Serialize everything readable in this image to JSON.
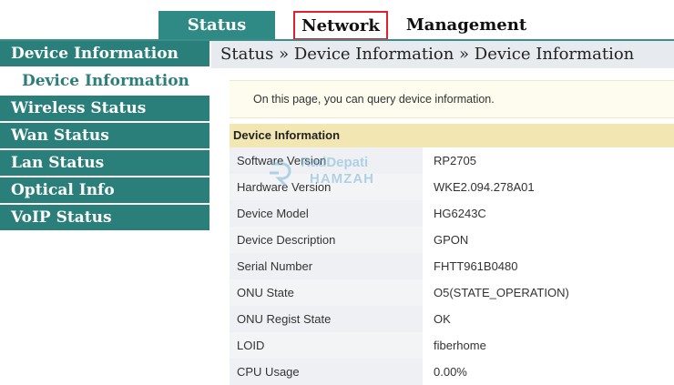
{
  "tabs": [
    {
      "label": "Status",
      "active": true
    },
    {
      "label": "Network",
      "highlighted": true
    },
    {
      "label": "Management"
    }
  ],
  "sidebar": {
    "items": [
      {
        "label": "Device Information",
        "type": "section"
      },
      {
        "label": "Device Information",
        "type": "sub",
        "selected": true
      },
      {
        "label": "Wireless Status",
        "type": "section"
      },
      {
        "label": "Wan Status",
        "type": "section"
      },
      {
        "label": "Lan Status",
        "type": "section"
      },
      {
        "label": "Optical Info",
        "type": "section"
      },
      {
        "label": "VoIP Status",
        "type": "section"
      }
    ]
  },
  "breadcrumb": "Status » Device Information » Device Information",
  "info_text": "On this page, you can query device information.",
  "section_title": "Device Information",
  "rows": [
    {
      "label": "Software Version",
      "value": "RP2705"
    },
    {
      "label": "Hardware Version",
      "value": "WKE2.094.278A01"
    },
    {
      "label": "Device Model",
      "value": "HG6243C"
    },
    {
      "label": "Device Description",
      "value": "GPON"
    },
    {
      "label": "Serial Number",
      "value": "FHTT961B0480"
    },
    {
      "label": "ONU State",
      "value": "O5(STATE_OPERATION)"
    },
    {
      "label": "ONU Regist State",
      "value": "OK"
    },
    {
      "label": "LOID",
      "value": "fiberhome"
    },
    {
      "label": "CPU Usage",
      "value": "0.00%"
    }
  ],
  "watermark": {
    "line1": "RadDepati",
    "line2": "HAMZAH",
    "icon": "rd-logo-icon"
  },
  "colors": {
    "teal": "#2b7f7b",
    "highlight_red": "#e0202a",
    "section_head_bg": "#f2e7b2"
  }
}
